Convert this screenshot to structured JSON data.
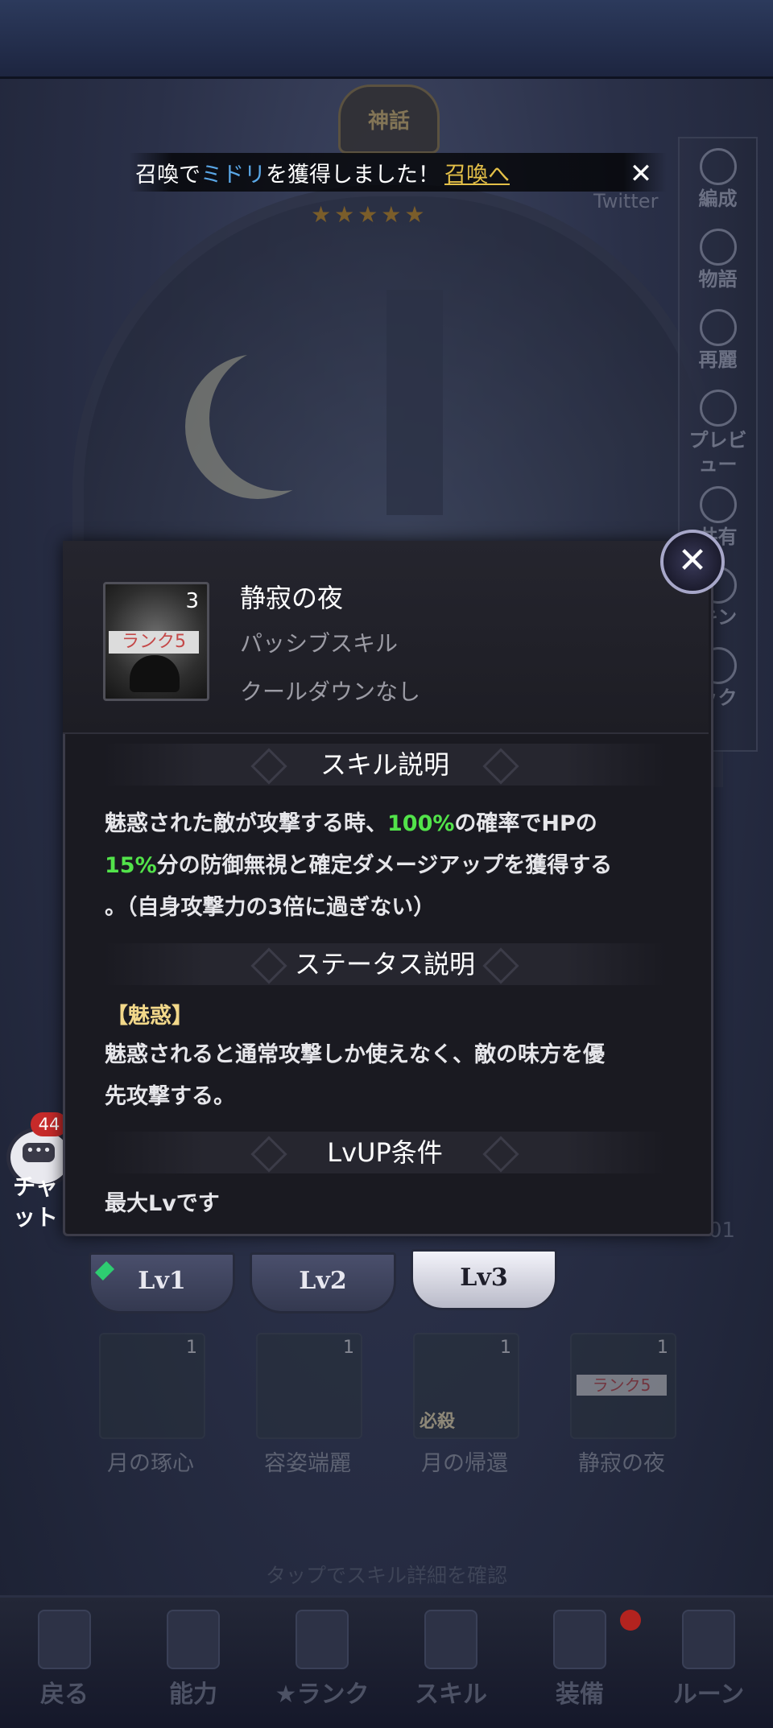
{
  "notification": {
    "prefix": "召喚で",
    "character": "ミドリ",
    "suffix": "を獲得しました！",
    "link": "召喚へ"
  },
  "header": {
    "emblem": "神話",
    "twitter": "Twitter"
  },
  "side_menu": {
    "items": [
      "編成",
      "物語",
      "再麗",
      "プレビュー",
      "共有",
      "キン",
      "ック"
    ]
  },
  "skill_popup": {
    "icon_level": "3",
    "icon_rank": "ランク5",
    "name": "静寂の夜",
    "type": "パッシブスキル",
    "cooldown": "クールダウンなし",
    "sections": {
      "skill_desc_title": "スキル説明",
      "skill_desc_1a": "魅惑された敵が攻撃する時、",
      "skill_desc_1b": "100%",
      "skill_desc_1c": "の確率でHPの",
      "skill_desc_2a": "15%",
      "skill_desc_2b": "分の防御無視と確定ダメージアップを獲得する",
      "skill_desc_3": "。（自身攻撃力の3倍に過ぎない）",
      "status_title": "ステータス説明",
      "status_name": "【魅惑】",
      "status_desc_1": "魅惑されると通常攻撃しか使えなく、敵の味方を優",
      "status_desc_2": "先攻撃する。",
      "lvup_title": "LvUP条件",
      "lvup_desc": "最大Lvです"
    },
    "colors": {
      "highlight": "#52e34a",
      "status_name": "#f2d88a"
    }
  },
  "level_tabs": [
    {
      "label": "Lv1",
      "active": false
    },
    {
      "label": "Lv2",
      "active": false
    },
    {
      "label": "Lv3",
      "active": true
    }
  ],
  "skills": [
    {
      "name": "月の琢心",
      "level": "1"
    },
    {
      "name": "容姿端麗",
      "level": "1"
    },
    {
      "name": "月の帰還",
      "level": "1",
      "tag": "必殺"
    },
    {
      "name": "静寂の夜",
      "level": "1",
      "rank": "ランク5"
    }
  ],
  "hint": "タップでスキル詳細を確認",
  "chat": {
    "badge": "44",
    "label": "チャット"
  },
  "page_num": "01",
  "bottom_nav": [
    {
      "label": "戻る",
      "icon": "back-icon"
    },
    {
      "label": "能力",
      "icon": "ability-icon"
    },
    {
      "label": "★ランク",
      "icon": "rank-icon"
    },
    {
      "label": "スキル",
      "icon": "skill-icon"
    },
    {
      "label": "装備",
      "icon": "equipment-icon"
    },
    {
      "label": "ルーン",
      "icon": "rune-icon"
    }
  ]
}
